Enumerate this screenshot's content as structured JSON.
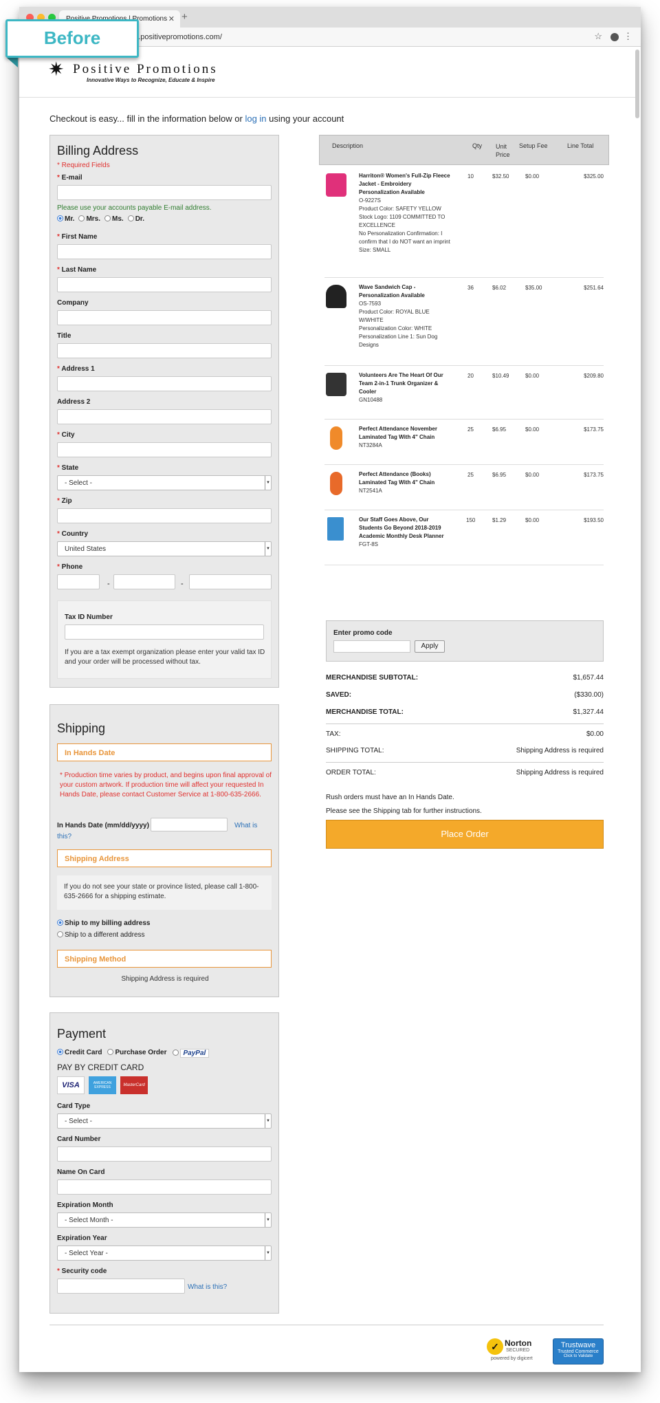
{
  "badge": {
    "label": "Before"
  },
  "browser": {
    "tab_title": "Positive Promotions | Promotions",
    "url": "www.positivepromotions.com/"
  },
  "header": {
    "brand": "Positive Promotions",
    "tagline": "Innovative Ways to Recognize, Educate & Inspire"
  },
  "intro": {
    "prefix": "Checkout is easy... fill in the information below or ",
    "link": "log in",
    "suffix": " using your account"
  },
  "billing": {
    "title": "Billing Address",
    "required_note": "* Required Fields",
    "email_label": "E-mail",
    "email_hint": "Please use your accounts payable E-mail address.",
    "salutations": [
      "Mr.",
      "Mrs.",
      "Ms.",
      "Dr."
    ],
    "first_name": "First Name",
    "last_name": "Last Name",
    "company": "Company",
    "title_field": "Title",
    "address1": "Address 1",
    "address2": "Address 2",
    "city": "City",
    "state": "State",
    "state_value": "- Select -",
    "zip": "Zip",
    "country": "Country",
    "country_value": "United States",
    "phone": "Phone",
    "phone_sep": "-",
    "tax_label": "Tax ID Number",
    "tax_note": "If you are a tax exempt organization please enter your valid tax ID and your order will be processed without tax."
  },
  "shipping": {
    "title": "Shipping",
    "in_hands_header": "In Hands Date",
    "production_note": "* Production time varies by product, and begins upon final approval of your custom artwork. If production time will affect your requested In Hands Date, please contact Customer Service at 1-800-635-2666.",
    "in_hands_label": "In Hands Date (mm/dd/yyyy)",
    "what_is_this": "What is this?",
    "address_header": "Shipping Address",
    "address_note": "If you do not see your state or province listed, please call 1-800-635-2666 for a shipping estimate.",
    "ship_billing": "Ship to my billing address",
    "ship_different": "Ship to a different address",
    "method_header": "Shipping Method",
    "method_note": "Shipping Address is required"
  },
  "payment": {
    "title": "Payment",
    "options": [
      "Credit Card",
      "Purchase Order",
      "PayPal"
    ],
    "pay_by": "PAY BY CREDIT CARD",
    "cards": [
      "VISA",
      "AMERICAN EXPRESS",
      "MasterCard"
    ],
    "card_type": "Card Type",
    "card_type_value": "- Select -",
    "card_number": "Card Number",
    "name_on_card": "Name On Card",
    "exp_month": "Expiration Month",
    "exp_month_value": "- Select Month -",
    "exp_year": "Expiration Year",
    "exp_year_value": "- Select Year -",
    "security": "Security code",
    "what_is_this": "What is this?"
  },
  "cart": {
    "columns": [
      "Description",
      "Qty",
      "Unit Price",
      "Setup Fee",
      "Line Total"
    ],
    "items": [
      {
        "name": "Harriton® Women's Full-Zip Fleece Jacket - Embroidery Personalization Available",
        "details": [
          "O-9227S",
          "Product Color: SAFETY YELLOW",
          "Stock Logo: 1109 COMMITTED TO EXCELLENCE",
          "No Personalization Confirmation: I confirm that I do NOT want an imprint",
          "Size: SMALL"
        ],
        "qty": "10",
        "unit": "$32.50",
        "setup": "$0.00",
        "total": "$325.00",
        "color": "#e0307a"
      },
      {
        "name": "Wave Sandwich Cap - Personalization Available",
        "details": [
          "OS-7593",
          "Product Color: ROYAL BLUE W/WHITE",
          "Personalization Color: WHITE",
          "Personalization Line 1: Sun Dog Designs"
        ],
        "qty": "36",
        "unit": "$6.02",
        "setup": "$35.00",
        "total": "$251.64",
        "color": "#222222"
      },
      {
        "name": "Volunteers Are The Heart Of Our Team 2-in-1 Trunk Organizer & Cooler",
        "details": [
          "GN10488"
        ],
        "qty": "20",
        "unit": "$10.49",
        "setup": "$0.00",
        "total": "$209.80",
        "color": "#333333"
      },
      {
        "name": "Perfect Attendance November Laminated Tag With 4\" Chain",
        "details": [
          "NT3284A"
        ],
        "qty": "25",
        "unit": "$6.95",
        "setup": "$0.00",
        "total": "$173.75",
        "color": "#f08a2a"
      },
      {
        "name": "Perfect Attendance (Books) Laminated Tag With 4\" Chain",
        "details": [
          "NT2541A"
        ],
        "qty": "25",
        "unit": "$6.95",
        "setup": "$0.00",
        "total": "$173.75",
        "color": "#e86a2a"
      },
      {
        "name": "Our Staff Goes Above, Our Students Go Beyond 2018-2019 Academic Monthly Desk Planner",
        "details": [
          "FGT-8S"
        ],
        "qty": "150",
        "unit": "$1.29",
        "setup": "$0.00",
        "total": "$193.50",
        "color": "#3a8fcf"
      }
    ]
  },
  "promo": {
    "label": "Enter promo code",
    "apply": "Apply"
  },
  "summary": {
    "subtotal_label": "MERCHANDISE SUBTOTAL:",
    "subtotal": "$1,657.44",
    "saved_label": "SAVED:",
    "saved": "($330.00)",
    "total_label": "MERCHANDISE TOTAL:",
    "total": "$1,327.44",
    "tax_label": "TAX:",
    "tax": "$0.00",
    "shipping_label": "SHIPPING TOTAL:",
    "shipping": "Shipping Address is required",
    "order_label": "ORDER TOTAL:",
    "order": "Shipping Address is required",
    "rush_note": "Rush orders must have an In Hands Date.",
    "see_note": "Please see the Shipping tab for further instructions.",
    "place_order": "Place Order"
  },
  "trust": {
    "norton_name": "Norton",
    "norton_sub": "SECURED",
    "norton_powered": "powered by digicert",
    "trustwave_name": "Trustwave",
    "trustwave_sub1": "Trusted Commerce",
    "trustwave_sub2": "Click to Validate"
  }
}
